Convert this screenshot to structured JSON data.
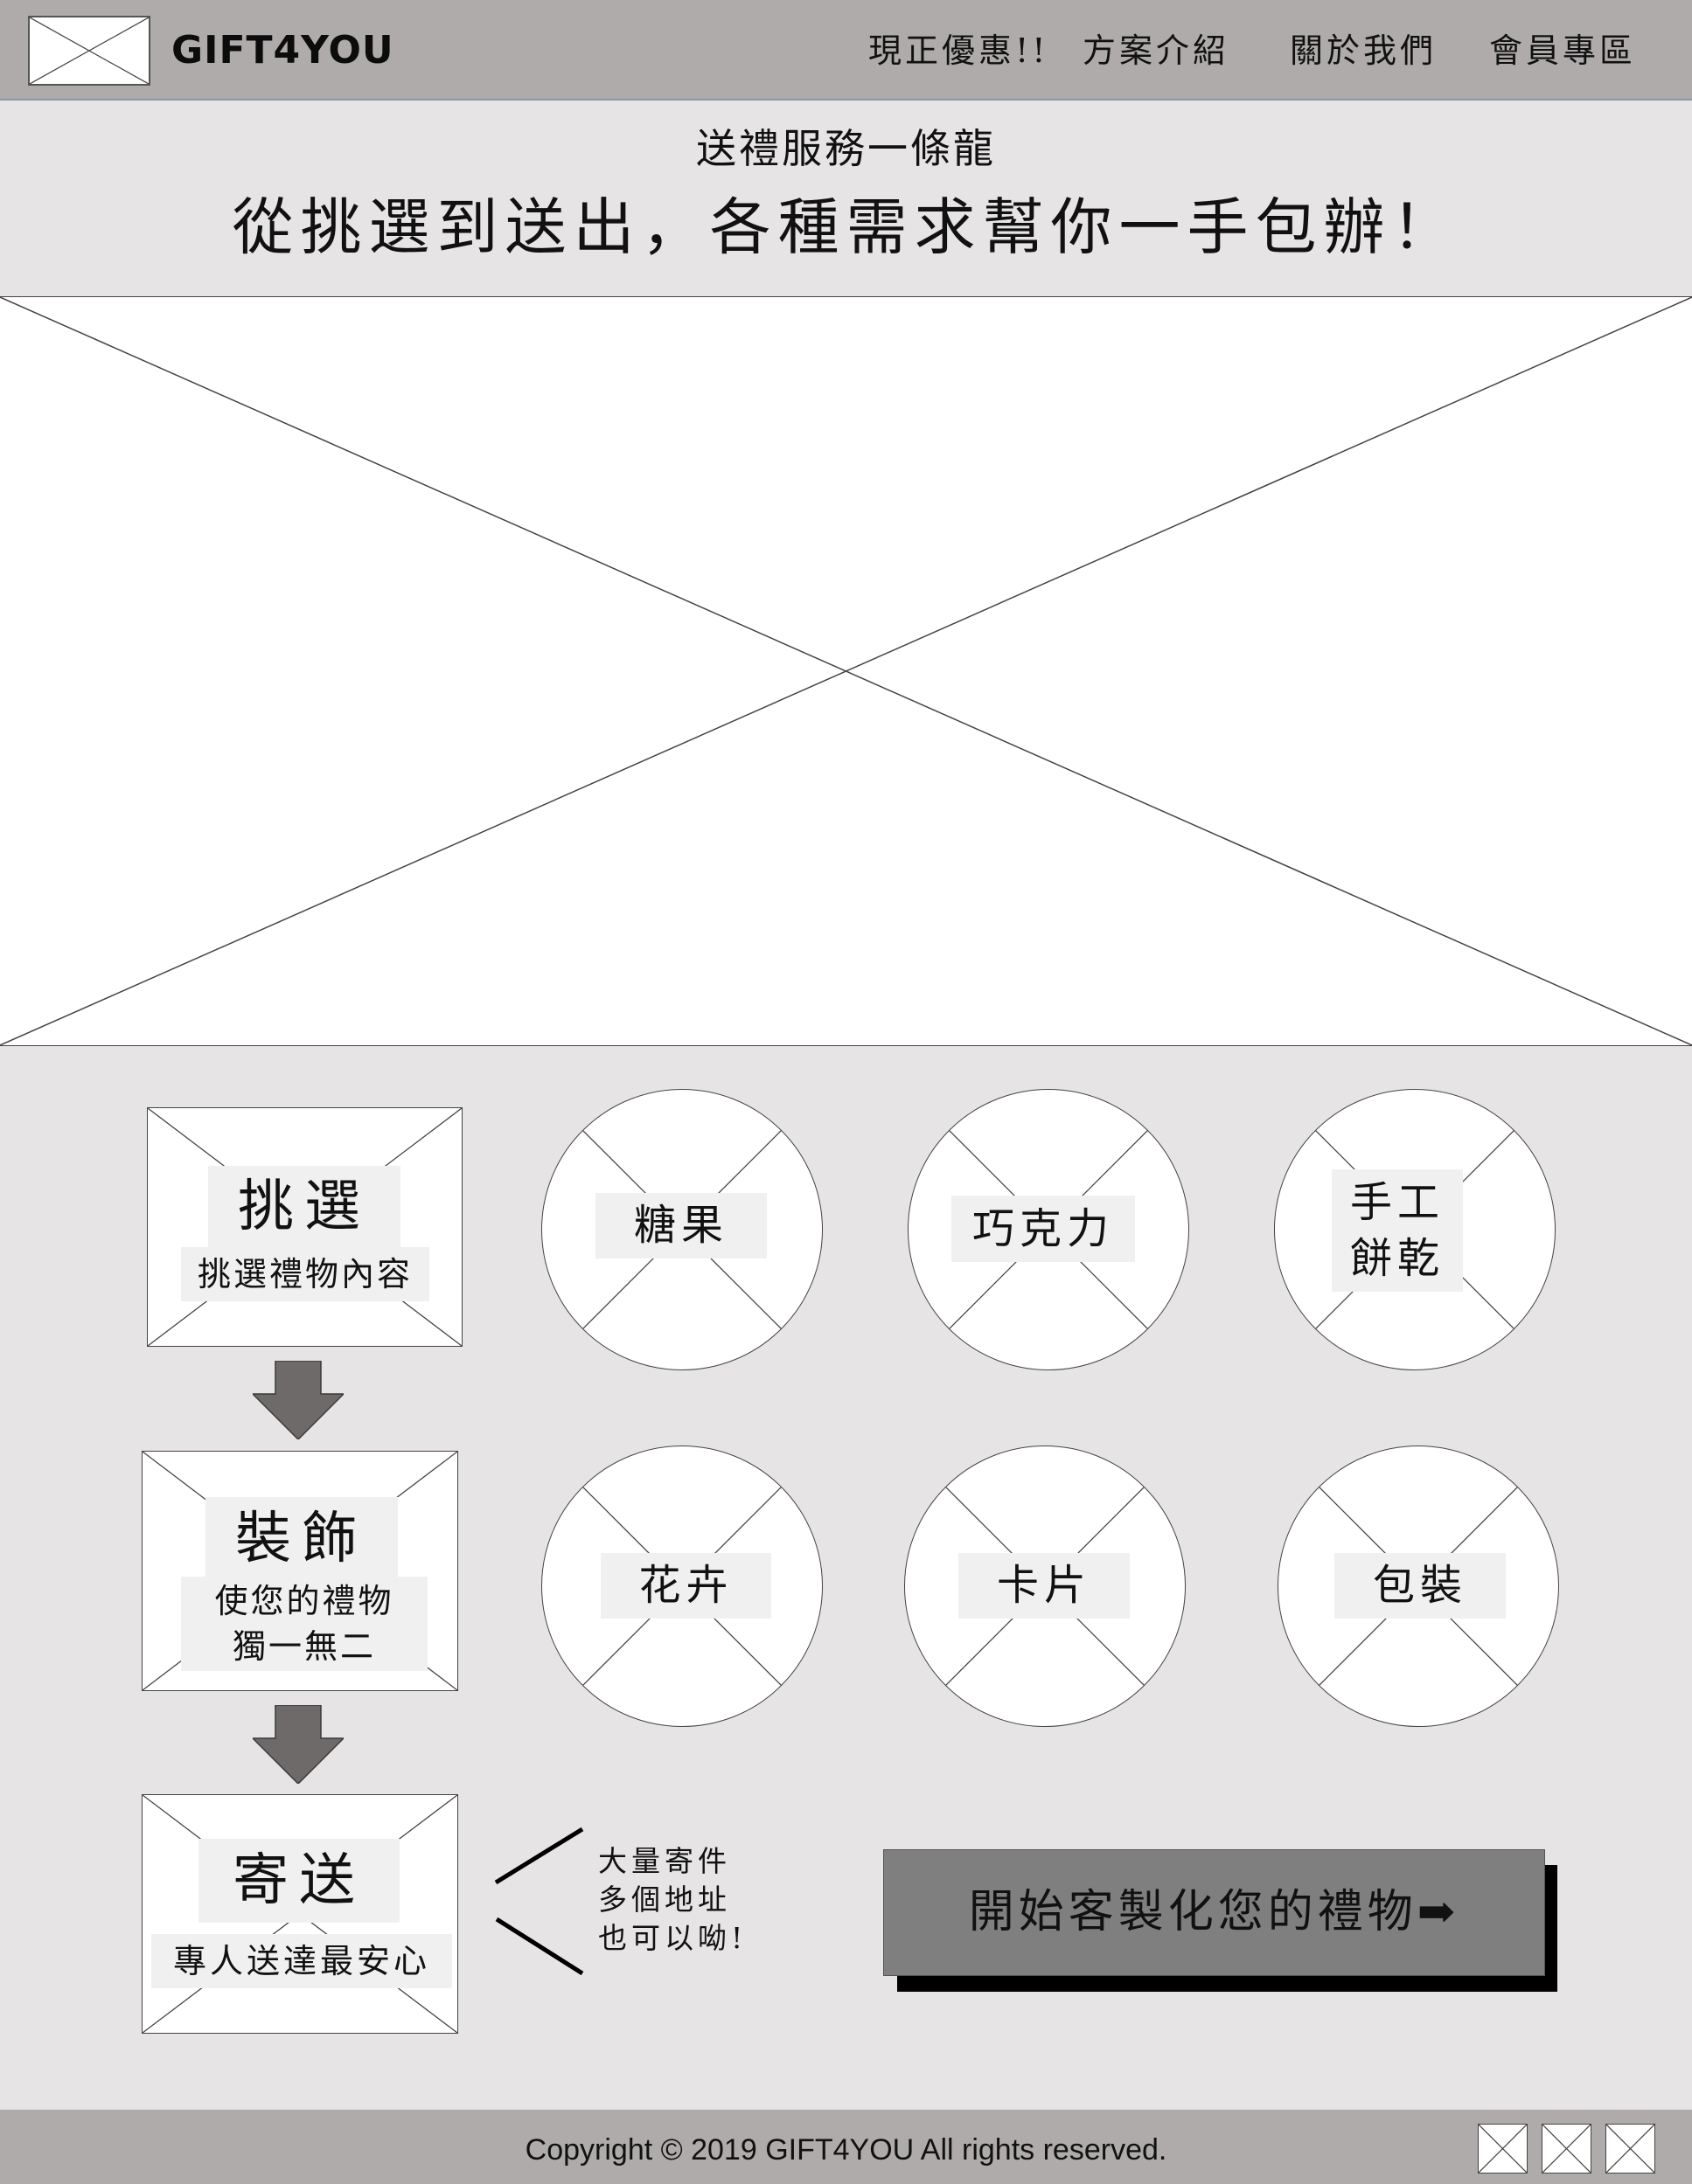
{
  "header": {
    "brand": "GIFT4YOU",
    "nav": [
      "現正優惠!!",
      "方案介紹",
      "關於我們",
      "會員專區"
    ]
  },
  "hero": {
    "subtitle": "送禮服務一條龍",
    "title": "從挑選到送出，各種需求幫你一手包辦！"
  },
  "steps": [
    {
      "title": "挑選",
      "desc": "挑選禮物內容"
    },
    {
      "title": "裝飾",
      "desc_lines": [
        "使您的禮物",
        "獨一無二"
      ]
    },
    {
      "title": "寄送",
      "desc": "專人送達最安心"
    }
  ],
  "categories": [
    {
      "label": "糖果"
    },
    {
      "label": "巧克力"
    },
    {
      "label_lines": [
        "手工",
        "餅乾"
      ]
    },
    {
      "label": "花卉"
    },
    {
      "label": "卡片"
    },
    {
      "label": "包裝"
    }
  ],
  "delivery_note": [
    "大量寄件",
    "多個地址",
    "也可以呦!"
  ],
  "cta": {
    "label": "開始客製化您的禮物➡"
  },
  "footer": {
    "copyright": "Copyright © 2019 GIFT4YOU All rights reserved."
  },
  "icons": [
    "logo-placeholder-icon",
    "arrow-down-icon",
    "arrow-right-icon",
    "social-icon"
  ],
  "colors": {
    "header_bg": "#afabab",
    "page_bg": "#e6e4e5",
    "cta_bg": "#7f7f7f",
    "arrow": "#6f6a6a"
  }
}
